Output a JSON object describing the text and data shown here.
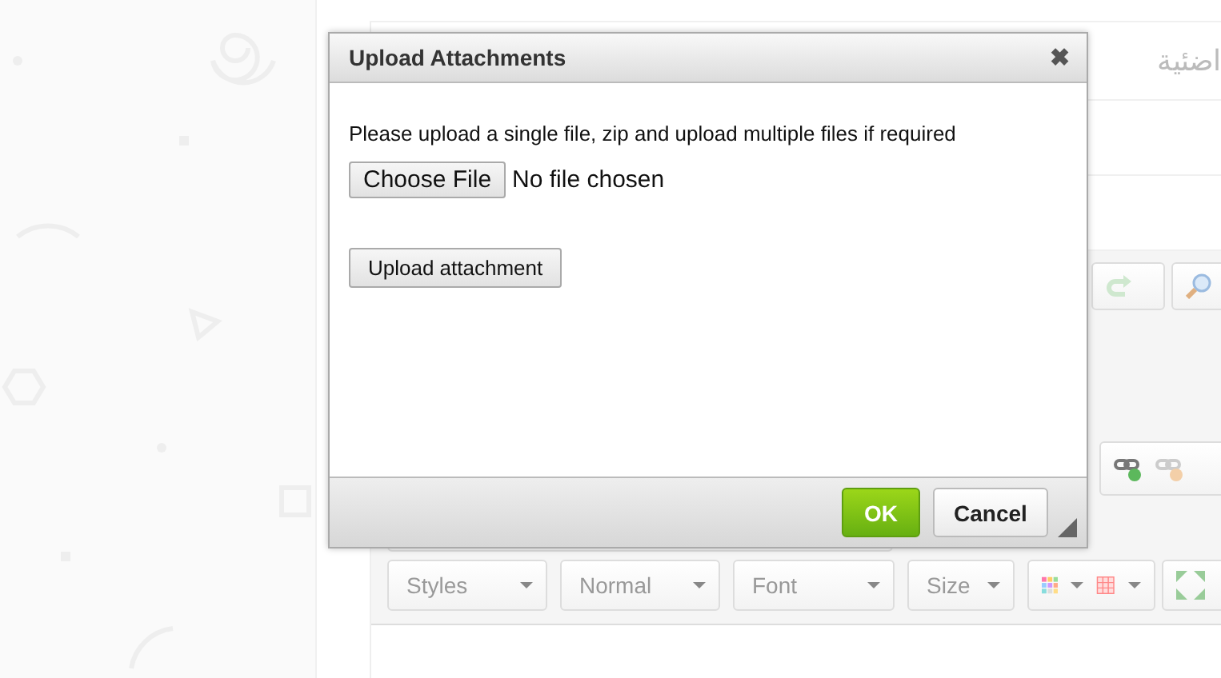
{
  "page": {
    "title": "اضئية",
    "dropdowns": [
      {
        "label": "Styles"
      },
      {
        "label": "Normal"
      },
      {
        "label": "Font"
      },
      {
        "label": "Size"
      }
    ]
  },
  "dialog": {
    "title": "Upload Attachments",
    "close": "✖",
    "instructions": "Please upload a single file, zip and upload multiple files if required",
    "file_input": {
      "button": "Choose File",
      "status": "No file chosen"
    },
    "upload_button": "Upload attachment",
    "buttons": [
      {
        "label": "OK",
        "kind": "primary"
      },
      {
        "label": "Cancel",
        "kind": "secondary"
      }
    ]
  }
}
